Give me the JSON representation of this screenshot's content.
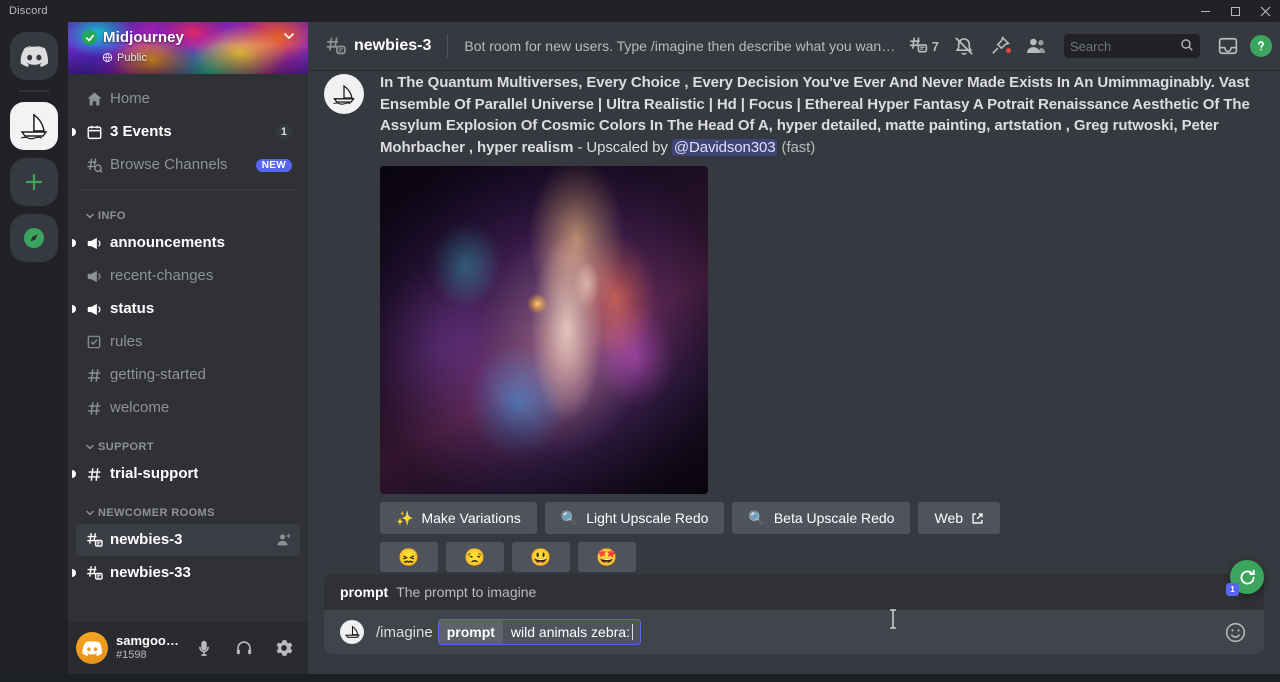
{
  "window": {
    "app_title": "Discord",
    "minimize_label": "Minimize",
    "maximize_label": "Maximize",
    "close_label": "Close"
  },
  "rail": {
    "home_label": "Discord Home",
    "servers": [
      {
        "name": "Midjourney",
        "icon": "sailboat-icon",
        "active": true
      }
    ],
    "add_server_label": "Add a Server",
    "explore_label": "Explore Public Servers"
  },
  "server": {
    "name": "Midjourney",
    "verified": true,
    "privacy_label": "Public",
    "dropdown_icon": "chevron-down-icon"
  },
  "sidebar": {
    "nav": [
      {
        "id": "home",
        "label": "Home",
        "icon": "home-icon",
        "unread": false,
        "badge": ""
      },
      {
        "id": "events",
        "label": "3 Events",
        "icon": "calendar-icon",
        "unread": true,
        "badge": "1"
      },
      {
        "id": "browse-channels",
        "label": "Browse Channels",
        "icon": "channel-search-icon",
        "unread": false,
        "badge": "NEW"
      }
    ],
    "categories": [
      {
        "name": "INFO",
        "channels": [
          {
            "label": "announcements",
            "icon": "announcement-icon",
            "unread": true
          },
          {
            "label": "recent-changes",
            "icon": "announcement-icon",
            "unread": false
          },
          {
            "label": "status",
            "icon": "announcement-icon",
            "unread": true
          },
          {
            "label": "rules",
            "icon": "rules-icon",
            "unread": false
          },
          {
            "label": "getting-started",
            "icon": "hash-icon",
            "unread": false
          },
          {
            "label": "welcome",
            "icon": "hash-icon",
            "unread": false
          }
        ]
      },
      {
        "name": "SUPPORT",
        "channels": [
          {
            "label": "trial-support",
            "icon": "hash-icon",
            "unread": true
          }
        ]
      },
      {
        "name": "NEWCOMER ROOMS",
        "channels": [
          {
            "label": "newbies-3",
            "icon": "forum-icon",
            "unread": false,
            "selected": true,
            "action_icon": "invite-member-icon"
          },
          {
            "label": "newbies-33",
            "icon": "forum-icon",
            "unread": true
          }
        ]
      }
    ]
  },
  "user_panel": {
    "username": "samgoodw...",
    "discriminator": "#1598",
    "mic_label": "Mute",
    "headset_label": "Deafen",
    "settings_label": "User Settings"
  },
  "channel_header": {
    "hash_icon": "forum-hash-icon",
    "name": "newbies-3",
    "topic": "Bot room for new users. Type /imagine then describe what you want to draw. S..",
    "threads_count": "7",
    "threads_label": "Threads",
    "notifications_label": "Notification Settings",
    "pinned_label": "Pinned Messages",
    "members_label": "Member List",
    "inbox_label": "Inbox",
    "help_label": "Help"
  },
  "search": {
    "placeholder": "Search",
    "value": "",
    "icon": "search-icon"
  },
  "message": {
    "author_avatar": "midjourney-bot-avatar",
    "prompt_text": "In The Quantum Multiverses, Every Choice , Every Decision You've Ever And Never Made Exists In An Umimmaginably. Vast Ensemble Of Parallel Universe | Ultra Realistic | Hd | Focus | Ethereal Hyper Fantasy A Potrait Renaissance Aesthetic Of The Assylum Explosion Of Cosmic Colors In The Head Of A, hyper detailed, matte painting, artstation , Greg rutwoski, Peter Mohrbacher , hyper realism",
    "separator": " - ",
    "upscaled_by_label": "Upscaled by",
    "mention": "@Davidson303",
    "speed_label": "(fast)",
    "image_alt": "cosmic-face-generated-image",
    "buttons": [
      {
        "label": "Make Variations",
        "icon": "sparkles-icon"
      },
      {
        "label": "Light Upscale Redo",
        "icon": "magnifier-icon"
      },
      {
        "label": "Beta Upscale Redo",
        "icon": "magnifier-icon"
      },
      {
        "label": "Web",
        "icon": "external-link-icon"
      }
    ],
    "reactions": [
      {
        "emoji": "😖",
        "name": "confounded-face-reaction"
      },
      {
        "emoji": "😒",
        "name": "unamused-face-reaction"
      },
      {
        "emoji": "😃",
        "name": "grinning-face-reaction"
      },
      {
        "emoji": "🤩",
        "name": "star-struck-face-reaction"
      }
    ]
  },
  "command_hint": {
    "option_name": "prompt",
    "option_description": "The prompt to imagine"
  },
  "composer": {
    "command": "/imagine",
    "arg_key": "prompt",
    "arg_value": "wild animals zebra:",
    "emoji_button_label": "Select emoji",
    "bot_avatar": "midjourney-bot-avatar"
  },
  "refresh_fab": {
    "label": "Reload",
    "icon": "refresh-icon",
    "badge": "1"
  },
  "colors": {
    "accent": "#5865f2",
    "green": "#3ba55d",
    "red": "#ed4245",
    "sidebar_bg": "#2f3136",
    "main_bg": "#36393f",
    "rail_bg": "#202225",
    "composer_bg": "#40444b"
  }
}
